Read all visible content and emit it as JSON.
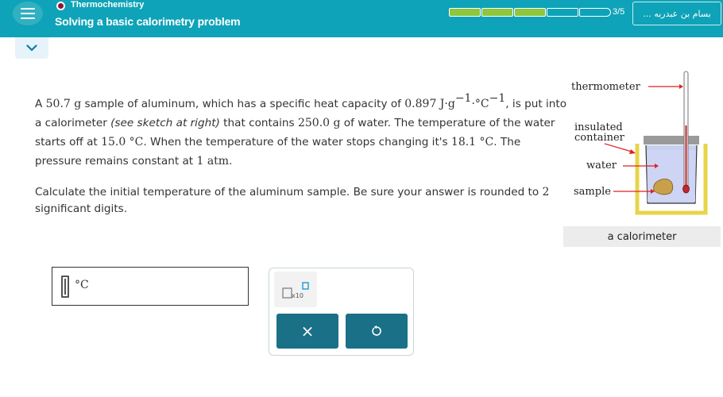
{
  "header": {
    "topic": "Thermochemistry",
    "title": "Solving a basic calorimetry problem",
    "progress_text": "3/5",
    "progress": {
      "completed": 3,
      "total": 5
    },
    "user_button": "... بسام بن عبدربه",
    "accent_color": "#0ea3b8",
    "progress_fill_color": "#8dc63f"
  },
  "problem": {
    "p1": "A ",
    "mass_al": "50.7 g",
    "p2": " sample of aluminum, which has a specific heat capacity of ",
    "c_value": "0.897 J·g",
    "exp1": "−1",
    "c_mid": "·°C",
    "exp2": "−1",
    "p3": ", is put into a calorimeter ",
    "see_sketch": "(see sketch at right)",
    "p4": " that contains ",
    "mass_water": "250.0 g",
    "p5": " of water. The temperature of the water starts off at ",
    "t_start": "15.0 °C",
    "p6": ". When the temperature of the water stops changing it's ",
    "t_final": "18.1 °C",
    "p7": ". The pressure remains constant at ",
    "pressure": "1 atm",
    "p8": "."
  },
  "question": {
    "q1": "Calculate the initial temperature of the aluminum sample. Be sure your answer is rounded to ",
    "sig_figs": "2",
    "q2": " significant digits."
  },
  "sketch": {
    "thermometer_label": "thermometer",
    "insulated_label_1": "insulated",
    "insulated_label_2": "container",
    "water_label": "water",
    "sample_label": "sample",
    "caption": "a calorimeter"
  },
  "answer": {
    "value": "",
    "unit": "°C"
  },
  "tools": {
    "sci_notation_label": "x10",
    "clear_label": "×"
  }
}
